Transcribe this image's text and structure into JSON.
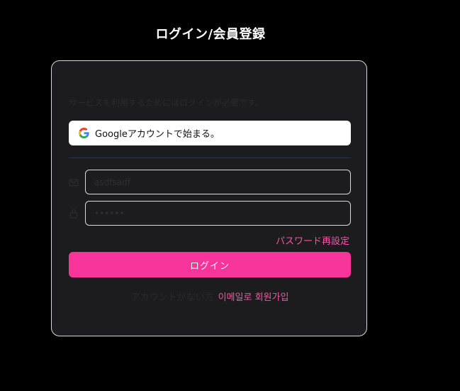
{
  "page": {
    "title": "ログイン/会員登録"
  },
  "card": {
    "intro_text": "サービスを利用するためにはログインが必要です。",
    "google_button_label": "Googleアカウントで始まる。",
    "email": {
      "value": "asdfsadf",
      "icon": "mail-icon"
    },
    "password": {
      "value": "••••••",
      "icon": "lock-icon"
    },
    "forgot_password_label": "パスワード再設定",
    "login_button_label": "ログイン",
    "signup_prompt": "アカウントがない方",
    "signup_link_label": "이메일로 회원가입"
  },
  "colors": {
    "background": "#000000",
    "card_background": "#1c1c1e",
    "accent": "#f7349a",
    "link": "#ff4fa8",
    "border": "#d9d9d9"
  }
}
